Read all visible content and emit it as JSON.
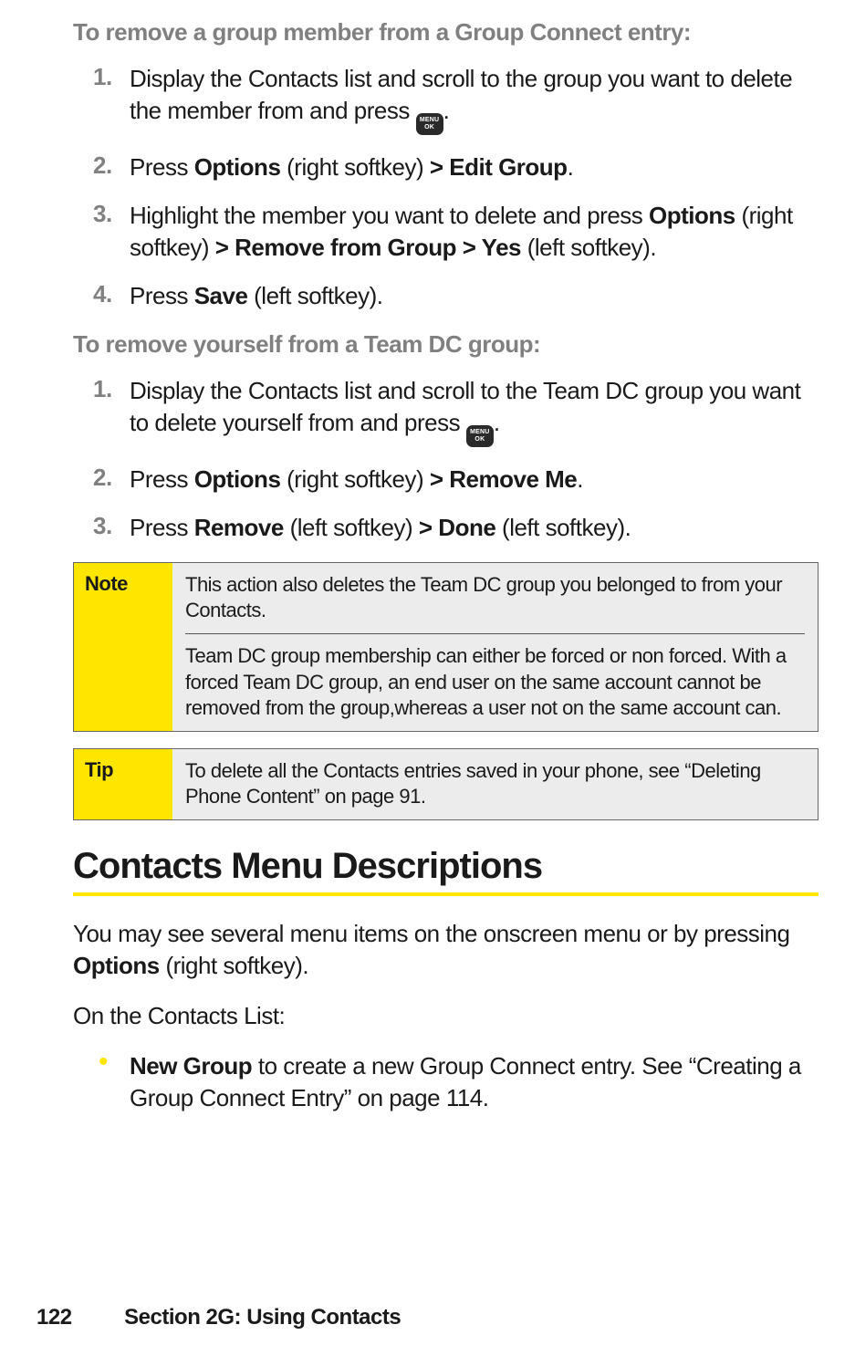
{
  "section1": {
    "heading": "To remove a group member from a Group Connect entry:",
    "steps": [
      {
        "num": "1.",
        "parts": [
          {
            "t": "Display the Contacts list and scroll to the group you want to delete the member from and press "
          },
          {
            "key": true,
            "l1": "MENU",
            "l2": "OK"
          },
          {
            "t": "."
          }
        ]
      },
      {
        "num": "2.",
        "parts": [
          {
            "t": "Press "
          },
          {
            "t": "Options",
            "b": true
          },
          {
            "t": " (right softkey) "
          },
          {
            "t": "> Edit Group",
            "b": true
          },
          {
            "t": "."
          }
        ]
      },
      {
        "num": "3.",
        "parts": [
          {
            "t": "Highlight the member you want to delete and press "
          },
          {
            "t": "Options",
            "b": true
          },
          {
            "t": " (right softkey) "
          },
          {
            "t": "> Remove from Group > Yes",
            "b": true
          },
          {
            "t": " (left softkey)."
          }
        ]
      },
      {
        "num": "4.",
        "parts": [
          {
            "t": "Press "
          },
          {
            "t": "Save",
            "b": true
          },
          {
            "t": " (left softkey)."
          }
        ]
      }
    ]
  },
  "section2": {
    "heading": "To remove yourself from a Team DC group:",
    "steps": [
      {
        "num": "1.",
        "parts": [
          {
            "t": "Display the Contacts list and scroll to the Team DC group you want to delete yourself from and press "
          },
          {
            "key": true,
            "l1": "MENU",
            "l2": "OK"
          },
          {
            "t": "."
          }
        ]
      },
      {
        "num": "2.",
        "parts": [
          {
            "t": "Press "
          },
          {
            "t": "Options",
            "b": true
          },
          {
            "t": " (right softkey) "
          },
          {
            "t": "> Remove Me",
            "b": true
          },
          {
            "t": "."
          }
        ]
      },
      {
        "num": "3.",
        "parts": [
          {
            "t": "Press "
          },
          {
            "t": "Remove",
            "b": true
          },
          {
            "t": " (left softkey) "
          },
          {
            "t": "> Done",
            "b": true
          },
          {
            "t": " (left softkey)."
          }
        ]
      }
    ]
  },
  "note": {
    "label": "Note",
    "paras": [
      "This action also deletes the Team DC group you belonged to from your Contacts.",
      "Team DC group membership can either be forced or non forced. With a forced Team DC group, an end user on the same account cannot be removed from the group,whereas a user not on the same account can."
    ]
  },
  "tip": {
    "label": "Tip",
    "paras": [
      "To delete all the Contacts entries saved in your phone, see “Deleting Phone Content” on page 91."
    ]
  },
  "title": "Contacts Menu Descriptions",
  "intro": {
    "parts": [
      {
        "t": "You may see several menu items on the onscreen menu or by pressing "
      },
      {
        "t": "Options",
        "b": true
      },
      {
        "t": " (right softkey)."
      }
    ]
  },
  "onlist": "On the Contacts List:",
  "bullets": [
    {
      "parts": [
        {
          "t": "New Group",
          "b": true
        },
        {
          "t": " to create a new Group Connect entry. See “Creating a Group Connect Entry” on page 114."
        }
      ]
    }
  ],
  "footer": {
    "page": "122",
    "section": "Section 2G: Using Contacts"
  }
}
